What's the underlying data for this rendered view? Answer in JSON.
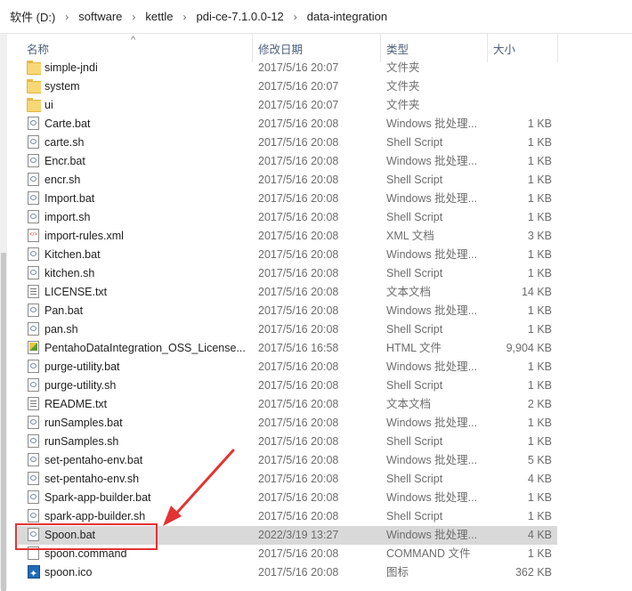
{
  "breadcrumb": [
    "软件 (D:)",
    "software",
    "kettle",
    "pdi-ce-7.1.0.0-12",
    "data-integration"
  ],
  "columns": {
    "name": "名称",
    "date": "修改日期",
    "type": "类型",
    "size": "大小"
  },
  "files": [
    {
      "icon": "folder-icon",
      "name": "simple-jndi",
      "date": "2017/5/16 20:07",
      "type": "文件夹",
      "size": ""
    },
    {
      "icon": "folder-icon",
      "name": "system",
      "date": "2017/5/16 20:07",
      "type": "文件夹",
      "size": ""
    },
    {
      "icon": "folder-icon",
      "name": "ui",
      "date": "2017/5/16 20:07",
      "type": "文件夹",
      "size": ""
    },
    {
      "icon": "batch-file-icon",
      "name": "Carte.bat",
      "date": "2017/5/16 20:08",
      "type": "Windows 批处理...",
      "size": "1 KB"
    },
    {
      "icon": "script-file-icon",
      "name": "carte.sh",
      "date": "2017/5/16 20:08",
      "type": "Shell Script",
      "size": "1 KB"
    },
    {
      "icon": "batch-file-icon",
      "name": "Encr.bat",
      "date": "2017/5/16 20:08",
      "type": "Windows 批处理...",
      "size": "1 KB"
    },
    {
      "icon": "script-file-icon",
      "name": "encr.sh",
      "date": "2017/5/16 20:08",
      "type": "Shell Script",
      "size": "1 KB"
    },
    {
      "icon": "batch-file-icon",
      "name": "Import.bat",
      "date": "2017/5/16 20:08",
      "type": "Windows 批处理...",
      "size": "1 KB"
    },
    {
      "icon": "script-file-icon",
      "name": "import.sh",
      "date": "2017/5/16 20:08",
      "type": "Shell Script",
      "size": "1 KB"
    },
    {
      "icon": "xml-file-icon",
      "name": "import-rules.xml",
      "date": "2017/5/16 20:08",
      "type": "XML 文档",
      "size": "3 KB"
    },
    {
      "icon": "batch-file-icon",
      "name": "Kitchen.bat",
      "date": "2017/5/16 20:08",
      "type": "Windows 批处理...",
      "size": "1 KB"
    },
    {
      "icon": "script-file-icon",
      "name": "kitchen.sh",
      "date": "2017/5/16 20:08",
      "type": "Shell Script",
      "size": "1 KB"
    },
    {
      "icon": "text-file-icon",
      "name": "LICENSE.txt",
      "date": "2017/5/16 20:08",
      "type": "文本文档",
      "size": "14 KB"
    },
    {
      "icon": "batch-file-icon",
      "name": "Pan.bat",
      "date": "2017/5/16 20:08",
      "type": "Windows 批处理...",
      "size": "1 KB"
    },
    {
      "icon": "script-file-icon",
      "name": "pan.sh",
      "date": "2017/5/16 20:08",
      "type": "Shell Script",
      "size": "1 KB"
    },
    {
      "icon": "html-file-icon",
      "name": "PentahoDataIntegration_OSS_License...",
      "date": "2017/5/16 16:58",
      "type": "HTML 文件",
      "size": "9,904 KB"
    },
    {
      "icon": "batch-file-icon",
      "name": "purge-utility.bat",
      "date": "2017/5/16 20:08",
      "type": "Windows 批处理...",
      "size": "1 KB"
    },
    {
      "icon": "script-file-icon",
      "name": "purge-utility.sh",
      "date": "2017/5/16 20:08",
      "type": "Shell Script",
      "size": "1 KB"
    },
    {
      "icon": "text-file-icon",
      "name": "README.txt",
      "date": "2017/5/16 20:08",
      "type": "文本文档",
      "size": "2 KB"
    },
    {
      "icon": "batch-file-icon",
      "name": "runSamples.bat",
      "date": "2017/5/16 20:08",
      "type": "Windows 批处理...",
      "size": "1 KB"
    },
    {
      "icon": "script-file-icon",
      "name": "runSamples.sh",
      "date": "2017/5/16 20:08",
      "type": "Shell Script",
      "size": "1 KB"
    },
    {
      "icon": "batch-file-icon",
      "name": "set-pentaho-env.bat",
      "date": "2017/5/16 20:08",
      "type": "Windows 批处理...",
      "size": "5 KB"
    },
    {
      "icon": "script-file-icon",
      "name": "set-pentaho-env.sh",
      "date": "2017/5/16 20:08",
      "type": "Shell Script",
      "size": "4 KB"
    },
    {
      "icon": "batch-file-icon",
      "name": "Spark-app-builder.bat",
      "date": "2017/5/16 20:08",
      "type": "Windows 批处理...",
      "size": "1 KB"
    },
    {
      "icon": "script-file-icon",
      "name": "spark-app-builder.sh",
      "date": "2017/5/16 20:08",
      "type": "Shell Script",
      "size": "1 KB"
    },
    {
      "icon": "batch-file-icon",
      "name": "Spoon.bat",
      "date": "2022/3/19 13:27",
      "type": "Windows 批处理...",
      "size": "4 KB",
      "selected": true
    },
    {
      "icon": "blank-file-icon",
      "name": "spoon.command",
      "date": "2017/5/16 20:08",
      "type": "COMMAND 文件",
      "size": "1 KB"
    },
    {
      "icon": "ico-file-icon",
      "name": "spoon.ico",
      "date": "2017/5/16 20:08",
      "type": "图标",
      "size": "362 KB"
    }
  ],
  "colors": {
    "highlight": "#e53232",
    "selected_row": "#d9d9d9"
  }
}
